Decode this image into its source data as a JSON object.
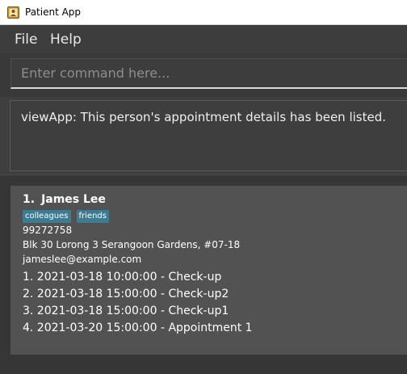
{
  "window": {
    "title": "Patient App",
    "icon": "address-book-icon"
  },
  "menu": {
    "file": "File",
    "help": "Help"
  },
  "command": {
    "placeholder": "Enter command here..."
  },
  "result": {
    "message": "viewApp: This person's appointment details has been listed."
  },
  "person": {
    "index": "1.",
    "name": "James Lee",
    "tags": [
      "colleagues",
      "friends"
    ],
    "phone": "99272758",
    "address": "Blk 30 Lorong 3 Serangoon Gardens, #07-18",
    "email": "jameslee@example.com",
    "appointments": [
      "1. 2021-03-18 10:00:00 - Check-up",
      "2. 2021-03-18 15:00:00 - Check-up2",
      "3. 2021-03-18 15:00:00 - Check-up1",
      "4. 2021-03-20 15:00:00 - Appointment 1"
    ]
  },
  "colors": {
    "tag_background": "#3e7b91",
    "window_background": "#3f3f3f",
    "card_background": "#525252"
  }
}
